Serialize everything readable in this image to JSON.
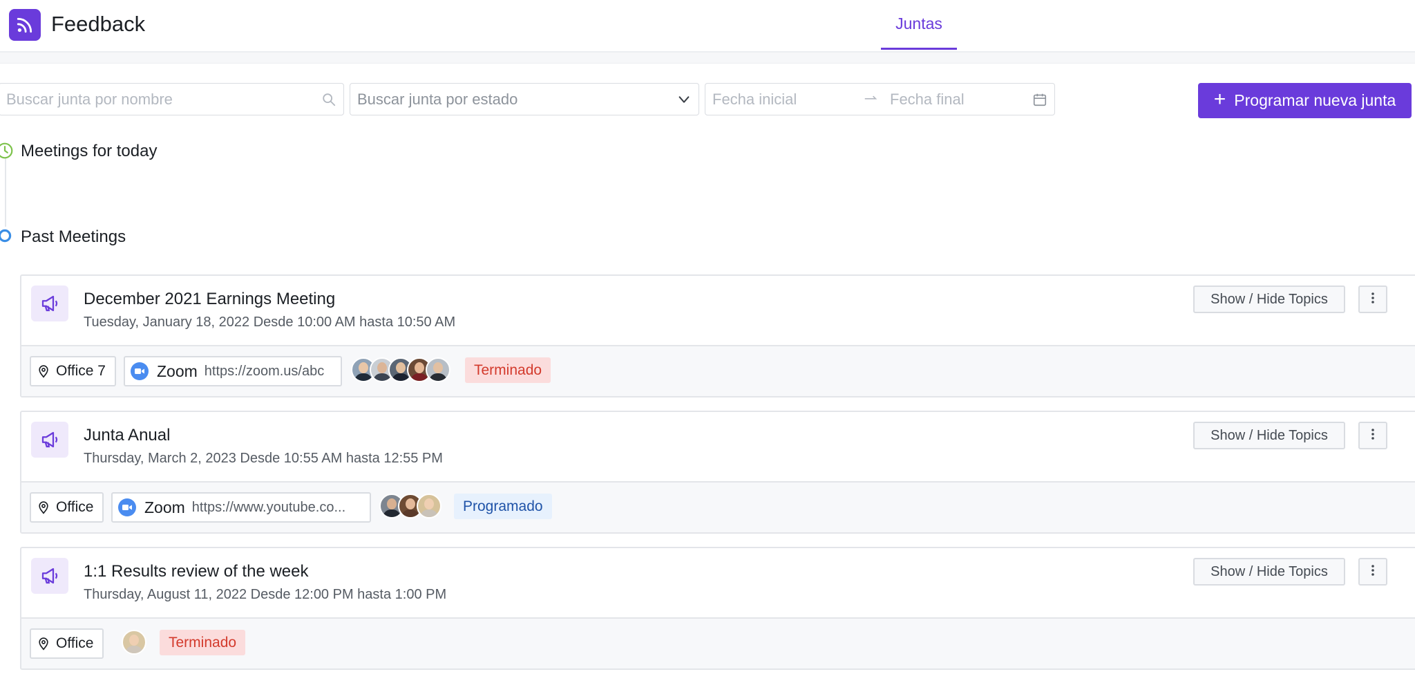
{
  "app": {
    "title": "Feedback"
  },
  "nav": {
    "tab": "Juntas"
  },
  "filters": {
    "name_placeholder": "Buscar junta por nombre",
    "state_placeholder": "Buscar junta por estado",
    "date_start_placeholder": "Fecha inicial",
    "date_end_placeholder": "Fecha final"
  },
  "actions": {
    "new_meeting": "Programar nueva junta"
  },
  "sections": {
    "today": "Meetings for today",
    "past": "Past Meetings"
  },
  "meetings": [
    {
      "title": "December 2021 Earnings Meeting",
      "date": "Tuesday, January 18, 2022 Desde 10:00 AM hasta 10:50 AM",
      "location": "Office 7",
      "zoom_label": "Zoom",
      "zoom_url": "https://zoom.us/abc",
      "status": "Terminado",
      "topics_label": "Show / Hide Topics"
    },
    {
      "title": "Junta Anual",
      "date": "Thursday, March 2, 2023 Desde 10:55 AM hasta 12:55 PM",
      "location": "Office",
      "zoom_label": "Zoom",
      "zoom_url": "https://www.youtube.co...",
      "status": "Programado",
      "topics_label": "Show / Hide Topics"
    },
    {
      "title": "1:1 Results review of the week",
      "date": "Thursday, August 11, 2022 Desde 12:00 PM hasta 1:00 PM",
      "location": "Office",
      "status": "Terminado",
      "topics_label": "Show / Hide Topics"
    }
  ],
  "colors": {
    "accent": "#6a3bdb",
    "done_bg": "#fbdcdc",
    "done_text": "#d33a2c",
    "scheduled_bg": "#e7f1fd",
    "scheduled_text": "#1f53a8",
    "today_icon": "#7cc24a",
    "past_icon": "#3a8ee6"
  },
  "icons": {
    "logo": "rss-icon",
    "search": "search-icon",
    "dropdown": "chevron-down-icon",
    "calendar": "calendar-icon",
    "today": "clock-icon",
    "past": "circle-icon",
    "meeting": "megaphone-icon",
    "location": "pin-icon",
    "zoom": "video-camera-icon",
    "more": "more-vertical-icon"
  }
}
